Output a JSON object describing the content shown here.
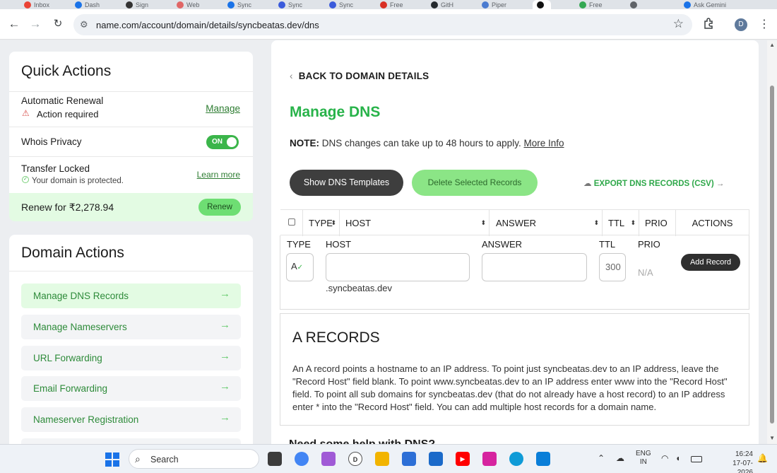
{
  "browser": {
    "tabs": [
      {
        "label": "Inbox",
        "color": "#ea4335"
      },
      {
        "label": "Dash",
        "color": "#1a73e8"
      },
      {
        "label": "Sign",
        "color": "#333333"
      },
      {
        "label": "Web",
        "color": "#e06666"
      },
      {
        "label": "Sync",
        "color": "#1a73e8"
      },
      {
        "label": "Sync",
        "color": "#3b5bdb"
      },
      {
        "label": "Sync",
        "color": "#3b5bdb"
      },
      {
        "label": "Free",
        "color": "#d93025"
      },
      {
        "label": "GitH",
        "color": "#24292e"
      },
      {
        "label": "Piper",
        "color": "#4a7bd0"
      },
      {
        "label": "",
        "color": "#111111"
      },
      {
        "label": "Free",
        "color": "#34a853"
      },
      {
        "label": "",
        "color": "#5f6368"
      },
      {
        "label": "Ask Gemini",
        "color": "#1a73e8"
      }
    ],
    "url": "name.com/account/domain/details/syncbeatas.dev/dns",
    "profile_initial": "D"
  },
  "quick_actions": {
    "title": "Quick Actions",
    "auto_renewal_label": "Automatic Renewal",
    "auto_renewal_status": "Action required",
    "manage_link": "Manage",
    "whois_label": "Whois Privacy",
    "whois_toggle": "ON",
    "transfer_label": "Transfer Locked",
    "transfer_status": "Your domain is protected.",
    "learn_more": "Learn more",
    "renew_text": "Renew for ₹2,278.94",
    "renew_button": "Renew"
  },
  "domain_actions": {
    "title": "Domain Actions",
    "items": [
      {
        "label": "Manage DNS Records"
      },
      {
        "label": "Manage Nameservers"
      },
      {
        "label": "URL Forwarding"
      },
      {
        "label": "Email Forwarding"
      },
      {
        "label": "Nameserver Registration"
      }
    ]
  },
  "dns": {
    "back_link": "BACK TO DOMAIN DETAILS",
    "title": "Manage DNS",
    "note_label": "NOTE:",
    "note_text": "DNS changes can take up to 48 hours to apply.",
    "note_link": "More Info",
    "show_templates_button": "Show DNS Templates",
    "delete_button": "Delete Selected Records",
    "export_link": "EXPORT DNS RECORDS (CSV)",
    "table_headers": {
      "type": "TYPE",
      "host": "HOST",
      "answer": "ANSWER",
      "ttl": "TTL",
      "prio": "PRIO",
      "actions": "ACTIONS"
    },
    "add_row": {
      "type_label": "TYPE",
      "host_label": "HOST",
      "answer_label": "ANSWER",
      "ttl_label": "TTL",
      "prio_label": "PRIO",
      "type_value": "A",
      "ttl_value": "300",
      "prio_value": "N/A",
      "domain_suffix": ".syncbeatas.dev",
      "add_button": "Add Record"
    },
    "info": {
      "title": "A RECORDS",
      "text": "An A record points a hostname to an IP address. To point just syncbeatas.dev to an IP address, leave the \"Record Host\" field blank. To point www.syncbeatas.dev to an IP address enter www into the \"Record Host\" field. To point all sub domains for syncbeatas.dev (that do not already have a host record) to an IP address enter * into the \"Record Host\" field. You can add multiple host records for a domain name."
    },
    "next_heading": "Need some help with DNS?"
  },
  "taskbar": {
    "search_placeholder": "Search",
    "lang_top": "ENG",
    "lang_bottom": "IN",
    "time": "16:24",
    "date": "17-07-2026"
  }
}
